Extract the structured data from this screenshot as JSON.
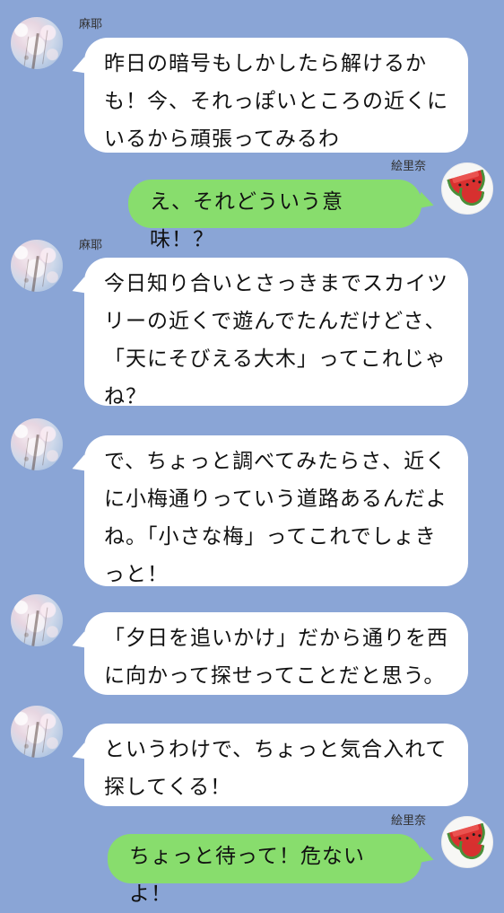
{
  "chat": {
    "messages": [
      {
        "sender": "麻耶",
        "text": "昨日の暗号もしかしたら解けるか\nも！今、それっぽいところの近くに\nいるから頑張ってみるわ",
        "side": "left",
        "avatar": "cherry-blossom-avatar"
      },
      {
        "sender": "絵里奈",
        "text": "え、それどういう意味！？",
        "side": "right",
        "avatar": "watermelon-avatar"
      },
      {
        "sender": "麻耶",
        "text": "今日知り合いとさっきまでスカイツ\nリーの近くで遊んでたんだけどさ、\n「天にそびえる大木」ってこれじゃ\nね？",
        "side": "left",
        "avatar": "cherry-blossom-avatar"
      },
      {
        "sender": "",
        "text": "で、ちょっと調べてみたらさ、近く\nに小梅通りっていう道路あるんだよ\nね。「小さな梅」ってこれでしょき\nっと！",
        "side": "left",
        "avatar": "cherry-blossom-avatar"
      },
      {
        "sender": "",
        "text": "「夕日を追いかけ」だから通りを西\nに向かって探せってことだと思う。",
        "side": "left",
        "avatar": "cherry-blossom-avatar"
      },
      {
        "sender": "",
        "text": "というわけで、ちょっと気合入れて\n探してくる！",
        "side": "left",
        "avatar": "cherry-blossom-avatar"
      },
      {
        "sender": "絵里奈",
        "text": "ちょっと待って！危ないよ！",
        "side": "right",
        "avatar": "watermelon-avatar"
      }
    ]
  },
  "colors": {
    "background": "#8aa5d6",
    "incoming_bubble": "#ffffff",
    "outgoing_bubble": "#88dd6d",
    "text": "#111111"
  }
}
